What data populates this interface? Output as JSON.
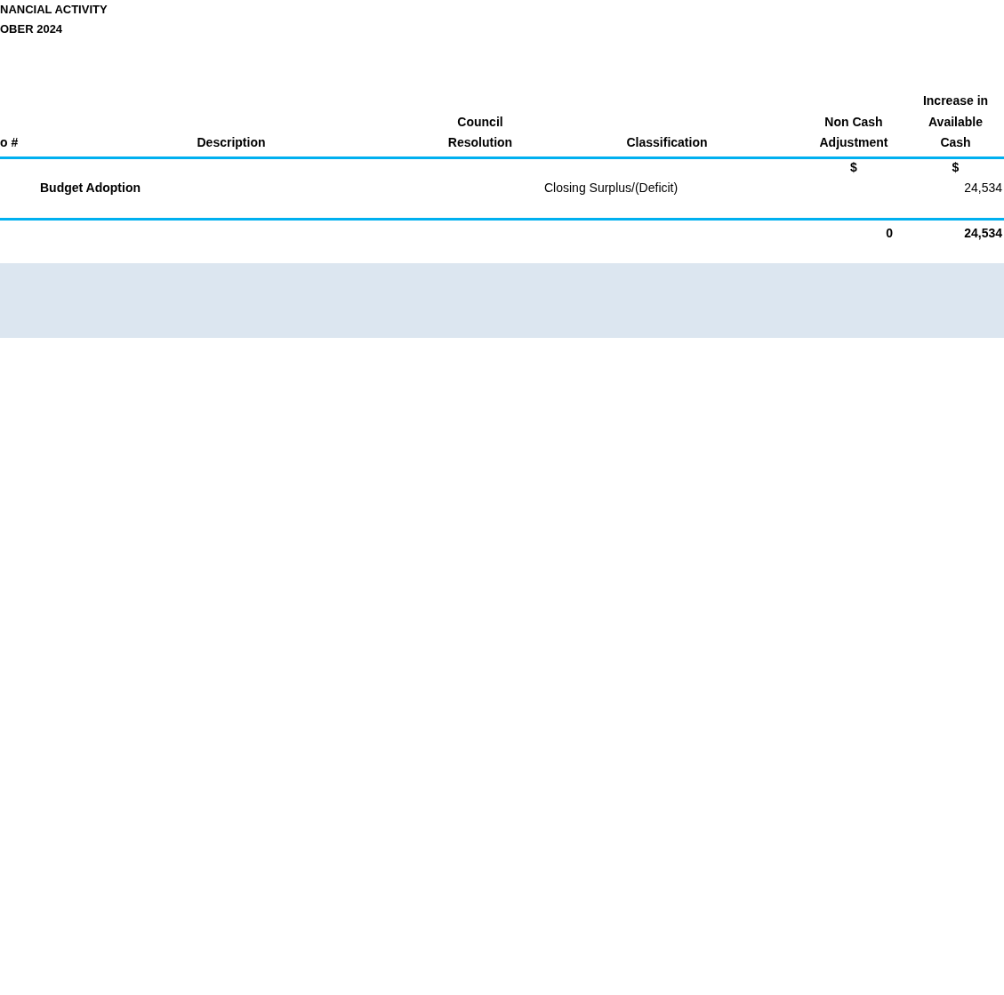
{
  "title_lines": [
    "NANCIAL ACTIVITY",
    "OBER 2024"
  ],
  "table": {
    "columns": [
      {
        "lines": [
          "o #"
        ]
      },
      {
        "lines": [
          "Description"
        ]
      },
      {
        "lines": [
          "Council",
          "Resolution"
        ]
      },
      {
        "lines": [
          "Classification"
        ]
      },
      {
        "lines": [
          "Non Cash",
          "Adjustment"
        ]
      },
      {
        "lines": [
          "Increase in",
          "Available",
          "Cash"
        ]
      }
    ],
    "currency_units": [
      "$",
      "$"
    ],
    "rows": [
      {
        "description": "Budget Adoption",
        "classification": "Closing Surplus/(Deficit)",
        "increase_in_available_cash": "24,534"
      }
    ],
    "totals": {
      "non_cash_adjustment": "0",
      "increase_in_available_cash": "24,534"
    }
  }
}
